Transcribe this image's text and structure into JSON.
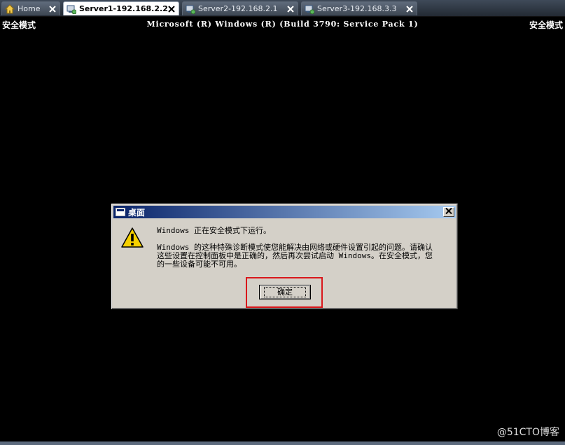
{
  "tabs": [
    {
      "label": "Home",
      "icon": "home-icon",
      "active": false
    },
    {
      "label": "Server1-192.168.2.2",
      "icon": "vm-icon",
      "active": true
    },
    {
      "label": "Server2-192.168.2.1",
      "icon": "vm-icon",
      "active": false
    },
    {
      "label": "Server3-192.168.3.3",
      "icon": "vm-icon",
      "active": false
    }
  ],
  "console": {
    "safe_mode_left": "安全模式",
    "safe_mode_right": "安全模式",
    "title": "Microsoft (R) Windows (R) (Build 3790: Service Pack 1)"
  },
  "dialog": {
    "title": "桌面",
    "line1": "Windows 正在安全模式下运行。",
    "line2": "Windows 的这种特殊诊断模式使您能解决由网络或硬件设置引起的问题。请确认\n这些设置在控制面板中是正确的，然后再次尝试启动 Windows。在安全模式，您\n的一些设备可能不可用。",
    "ok_label": "确定"
  },
  "watermark": "@51CTO博客",
  "colors": {
    "highlight": "#d9171b",
    "titlebar_start": "#0a246a",
    "titlebar_end": "#a6caf0"
  }
}
